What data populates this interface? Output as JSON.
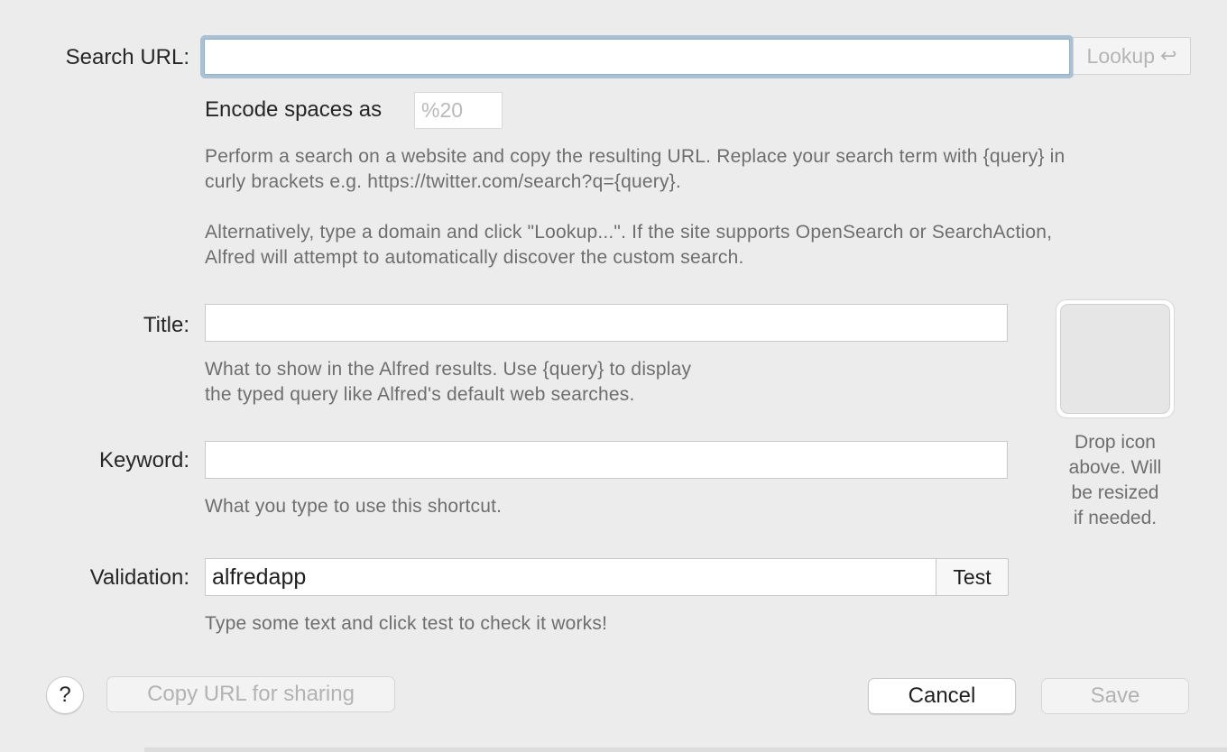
{
  "search_url": {
    "label": "Search URL:",
    "value": "",
    "lookup_label": "Lookup",
    "lookup_icon": "return-arrow-icon"
  },
  "encode": {
    "label": "Encode spaces as",
    "placeholder": "%20"
  },
  "search_url_help": {
    "line1": "Perform a search on a website and copy the resulting URL. Replace your search term with {query} in",
    "line2": "curly brackets e.g. https://twitter.com/search?q={query}.",
    "line3": "Alternatively, type a domain and click \"Lookup...\". If the site supports OpenSearch or SearchAction,",
    "line4": "Alfred will attempt to automatically discover the custom search."
  },
  "title": {
    "label": "Title:",
    "value": "",
    "help_line1": "What to show in the Alfred results. Use {query} to display",
    "help_line2": "the typed query like Alfred's default web searches."
  },
  "keyword": {
    "label": "Keyword:",
    "value": "",
    "help": "What you type to use this shortcut."
  },
  "validation": {
    "label": "Validation:",
    "value": "alfredapp",
    "test_label": "Test",
    "help": "Type some text and click test to check it works!"
  },
  "icon_drop": {
    "caption_line1": "Drop icon",
    "caption_line2": "above. Will",
    "caption_line3": "be resized",
    "caption_line4": "if needed."
  },
  "footer": {
    "help_label": "?",
    "copy_url_label": "Copy URL for sharing",
    "cancel_label": "Cancel",
    "save_label": "Save"
  }
}
